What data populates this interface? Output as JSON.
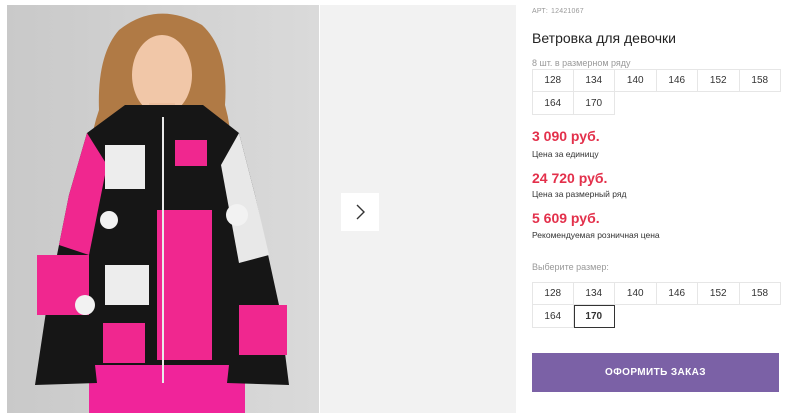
{
  "product": {
    "art_label": "АРТ:",
    "art_number": "12421067",
    "title": "Ветровка для девочки"
  },
  "size_row": {
    "hint": "8 шт. в размерном ряду",
    "sizes": [
      "128",
      "134",
      "140",
      "146",
      "152",
      "158",
      "164",
      "170"
    ]
  },
  "prices": [
    {
      "value": "3 090 руб.",
      "label": "Цена за единицу"
    },
    {
      "value": "24 720 руб.",
      "label": "Цена за размерный ряд"
    },
    {
      "value": "5 609 руб.",
      "label": "Рекомендуемая розничная цена"
    }
  ],
  "size_picker": {
    "hint": "Выберите размер:",
    "sizes": [
      "128",
      "134",
      "140",
      "146",
      "152",
      "158",
      "164",
      "170"
    ],
    "selected": "170"
  },
  "order_button": {
    "label": "ОФОРМИТЬ ЗАКАЗ"
  },
  "colors": {
    "price": "#e3304b",
    "button": "#7b61a6"
  },
  "icons": {
    "gallery_next": "chevron-right-icon"
  }
}
